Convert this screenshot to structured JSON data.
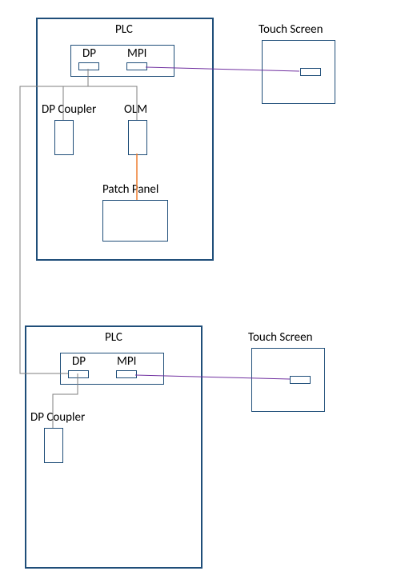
{
  "top": {
    "plc_label": "PLC",
    "dp_label": "DP",
    "mpi_label": "MPI",
    "touchscreen_label": "Touch Screen",
    "dp_coupler_label": "DP Coupler",
    "olm_label": "OLM",
    "patch_panel_label": "Patch Panel"
  },
  "bottom": {
    "plc_label": "PLC",
    "dp_label": "DP",
    "mpi_label": "MPI",
    "touchscreen_label": "Touch Screen",
    "dp_coupler_label": "DP Coupler"
  },
  "colors": {
    "border": "#1f4e79",
    "wire_mpi": "#7030a0",
    "wire_dp": "#7f7f7f",
    "wire_fiber": "#ed7d31"
  }
}
